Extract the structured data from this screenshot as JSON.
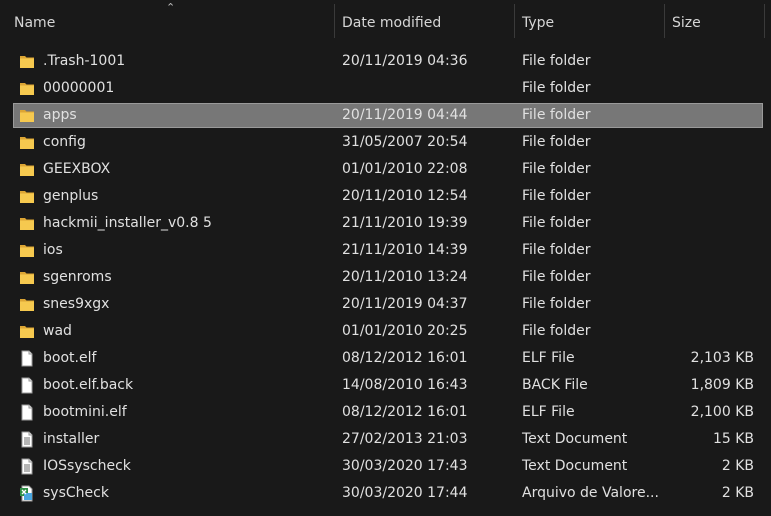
{
  "columns": {
    "name": "Name",
    "date": "Date modified",
    "type": "Type",
    "size": "Size",
    "sort_indicator": "^"
  },
  "selected_index": 2,
  "icons": {
    "folder": "folder-icon",
    "file": "file-icon",
    "text": "text-document-icon",
    "data": "data-file-icon"
  },
  "colors": {
    "background": "#191919",
    "selection": "#777777",
    "folder": "#f2c34e"
  },
  "rows": [
    {
      "name": ".Trash-1001",
      "date": "20/11/2019 04:36",
      "type": "File folder",
      "size": "",
      "icon": "folder"
    },
    {
      "name": "00000001",
      "date": "",
      "type": "File folder",
      "size": "",
      "icon": "folder"
    },
    {
      "name": "apps",
      "date": "20/11/2019 04:44",
      "type": "File folder",
      "size": "",
      "icon": "folder"
    },
    {
      "name": "config",
      "date": "31/05/2007 20:54",
      "type": "File folder",
      "size": "",
      "icon": "folder"
    },
    {
      "name": "GEEXBOX",
      "date": "01/01/2010 22:08",
      "type": "File folder",
      "size": "",
      "icon": "folder"
    },
    {
      "name": "genplus",
      "date": "20/11/2010 12:54",
      "type": "File folder",
      "size": "",
      "icon": "folder"
    },
    {
      "name": "hackmii_installer_v0.8 5",
      "date": "21/11/2010 19:39",
      "type": "File folder",
      "size": "",
      "icon": "folder"
    },
    {
      "name": "ios",
      "date": "21/11/2010 14:39",
      "type": "File folder",
      "size": "",
      "icon": "folder"
    },
    {
      "name": "sgenroms",
      "date": "20/11/2010 13:24",
      "type": "File folder",
      "size": "",
      "icon": "folder"
    },
    {
      "name": "snes9xgx",
      "date": "20/11/2019 04:37",
      "type": "File folder",
      "size": "",
      "icon": "folder"
    },
    {
      "name": "wad",
      "date": "01/01/2010 20:25",
      "type": "File folder",
      "size": "",
      "icon": "folder"
    },
    {
      "name": "boot.elf",
      "date": "08/12/2012 16:01",
      "type": "ELF File",
      "size": "2,103 KB",
      "icon": "file"
    },
    {
      "name": "boot.elf.back",
      "date": "14/08/2010 16:43",
      "type": "BACK File",
      "size": "1,809 KB",
      "icon": "file"
    },
    {
      "name": "bootmini.elf",
      "date": "08/12/2012 16:01",
      "type": "ELF File",
      "size": "2,100 KB",
      "icon": "file"
    },
    {
      "name": "installer",
      "date": "27/02/2013 21:03",
      "type": "Text Document",
      "size": "15 KB",
      "icon": "text"
    },
    {
      "name": "IOSsyscheck",
      "date": "30/03/2020 17:43",
      "type": "Text Document",
      "size": "2 KB",
      "icon": "text"
    },
    {
      "name": "sysCheck",
      "date": "30/03/2020 17:44",
      "type": "Arquivo de Valore...",
      "size": "2 KB",
      "icon": "data"
    }
  ]
}
